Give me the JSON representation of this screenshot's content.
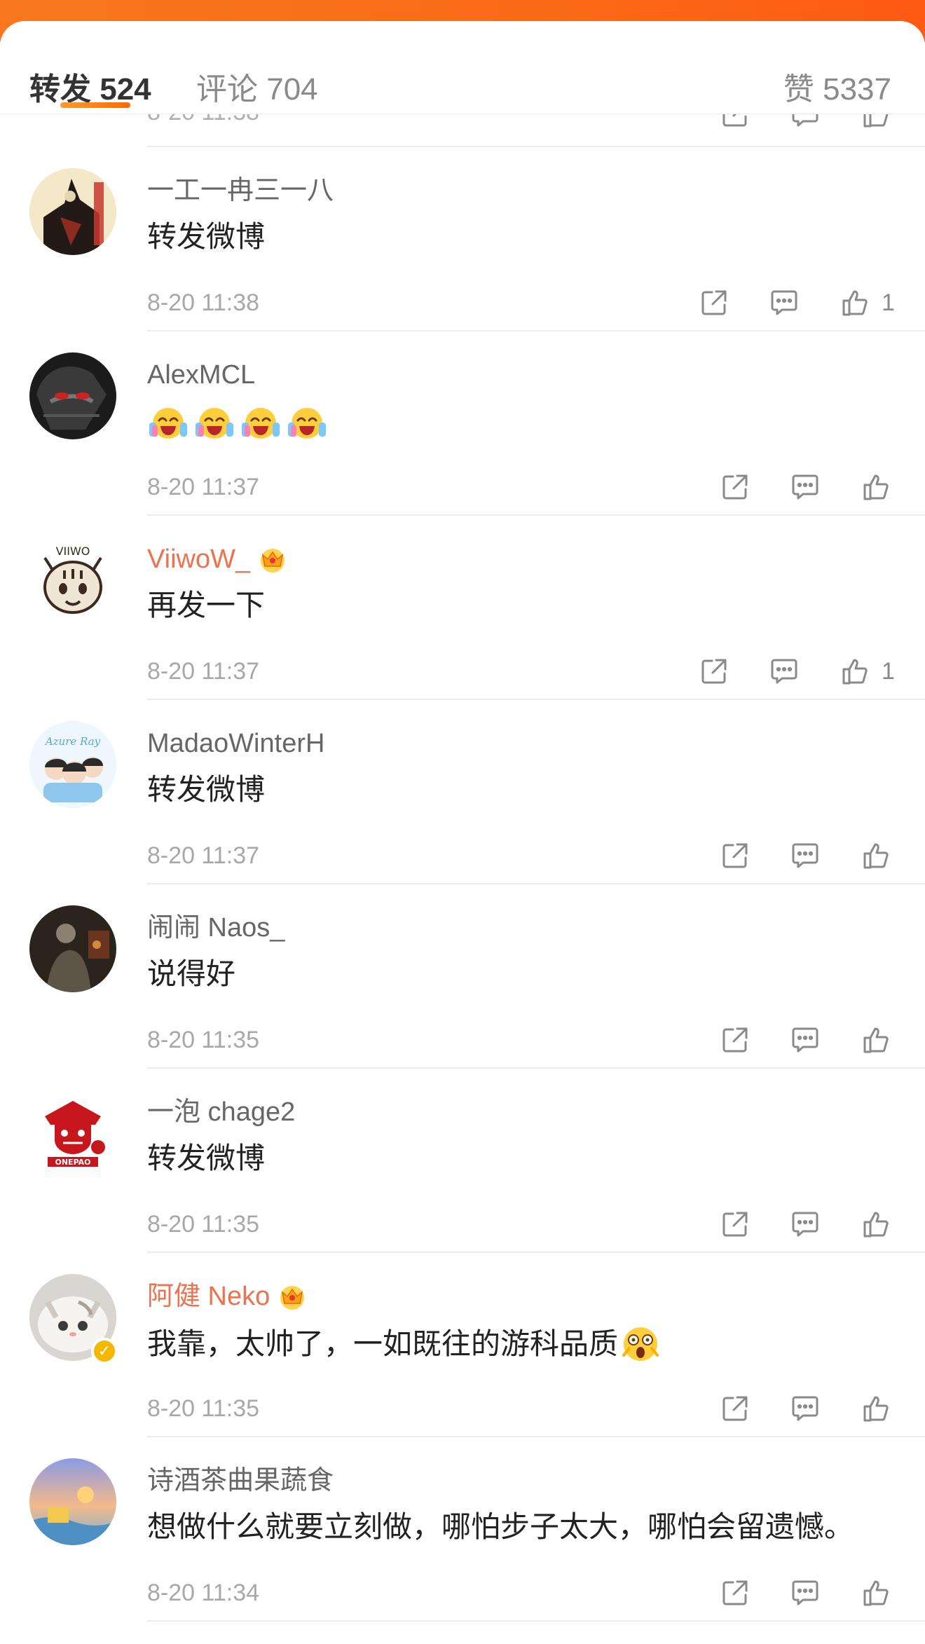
{
  "tabs": {
    "forward_label": "转发 524",
    "comment_label": "评论 704",
    "like_label": "赞 5337"
  },
  "partial_time": "8-20 11:38",
  "items": [
    {
      "name": "一工一冉三一八",
      "text": "转发微博",
      "time": "8-20 11:38",
      "likes": "1",
      "vip": false,
      "avatar": "ink-figure"
    },
    {
      "name": "AlexMCL",
      "text": "",
      "emoji_count": 4,
      "time": "8-20 11:37",
      "likes": "",
      "vip": false,
      "avatar": "dark-mask"
    },
    {
      "name": "ViiwoW_",
      "text": "再发一下",
      "time": "8-20 11:37",
      "likes": "1",
      "vip": true,
      "avatar": "cat-sketch"
    },
    {
      "name": "MadaoWinterH",
      "text": "转发微博",
      "time": "8-20 11:37",
      "likes": "",
      "vip": false,
      "avatar": "cartoon-group",
      "avatar_text": "Azure Ray"
    },
    {
      "name": "闹闹 Naos_",
      "text": "说得好",
      "time": "8-20 11:35",
      "likes": "",
      "vip": false,
      "avatar": "dark-photo"
    },
    {
      "name": "一泡 chage2",
      "text": "转发微博",
      "time": "8-20 11:35",
      "likes": "",
      "vip": false,
      "avatar": "red-logo",
      "avatar_text": "ONEPAO"
    },
    {
      "name": "阿健 Neko",
      "text": "我靠，太帅了，一如既往的游科品质",
      "time": "8-20 11:35",
      "likes": "",
      "vip": true,
      "verified": true,
      "avatar": "white-cat"
    },
    {
      "name": "诗酒茶曲果蔬食",
      "text": "想做什么就要立刻做，哪怕步子太大，哪怕会留遗憾。",
      "time": "8-20 11:34",
      "likes": "",
      "vip": false,
      "avatar": "sunset"
    }
  ],
  "colors": {
    "accent": "#ff8200",
    "vip_name": "#eb7350",
    "text": "#222222",
    "meta": "#a8a8a8"
  },
  "icons": [
    "share-icon",
    "comment-icon",
    "like-icon",
    "crown-icon",
    "laugh-emoji",
    "surprised-emoji",
    "verified-icon"
  ]
}
